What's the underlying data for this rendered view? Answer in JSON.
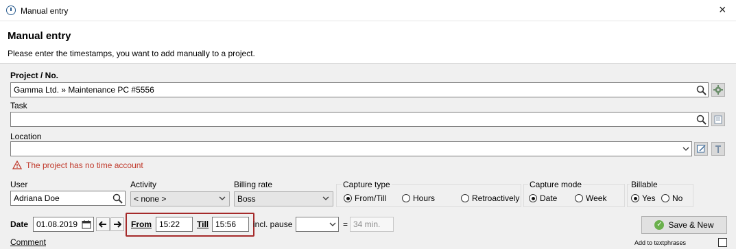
{
  "window": {
    "title": "Manual entry",
    "close": "×"
  },
  "header": {
    "title": "Manual entry",
    "subtitle": "Please enter the timestamps, you want to add manually to a project."
  },
  "project": {
    "label": "Project / No.",
    "value": "Gamma Ltd. » Maintenance PC #5556"
  },
  "task": {
    "label": "Task",
    "value": ""
  },
  "location": {
    "label": "Location",
    "value": ""
  },
  "warning": {
    "text": "The project has no time account"
  },
  "user": {
    "label": "User",
    "value": "Adriana Doe"
  },
  "activity": {
    "label": "Activity",
    "value": "< none >"
  },
  "billing_rate": {
    "label": "Billing rate",
    "value": "Boss"
  },
  "capture_type": {
    "label": "Capture type",
    "options": [
      {
        "label": "From/Till",
        "selected": true
      },
      {
        "label": "Hours",
        "selected": false
      },
      {
        "label": "Retroactively",
        "selected": false
      }
    ]
  },
  "capture_mode": {
    "label": "Capture mode",
    "options": [
      {
        "label": "Date",
        "selected": true
      },
      {
        "label": "Week",
        "selected": false
      }
    ]
  },
  "billable": {
    "label": "Billable",
    "options": [
      {
        "label": "Yes",
        "selected": true
      },
      {
        "label": "No",
        "selected": false
      }
    ]
  },
  "date": {
    "label": "Date",
    "value": "01.08.2019"
  },
  "from": {
    "label": "From",
    "value": "15:22"
  },
  "till": {
    "label": "Till",
    "value": "15:56"
  },
  "pause": {
    "label": "incl. pause",
    "value": "",
    "equals": "=",
    "result": "34 min."
  },
  "save": {
    "label": "Save & New"
  },
  "comment": {
    "label": "Comment"
  },
  "textphrases": {
    "label": "Add to textphrases"
  },
  "colors": {
    "warning": "#c0392b",
    "highlight_box": "#a52a2a",
    "save_check": "#6ab04c"
  }
}
